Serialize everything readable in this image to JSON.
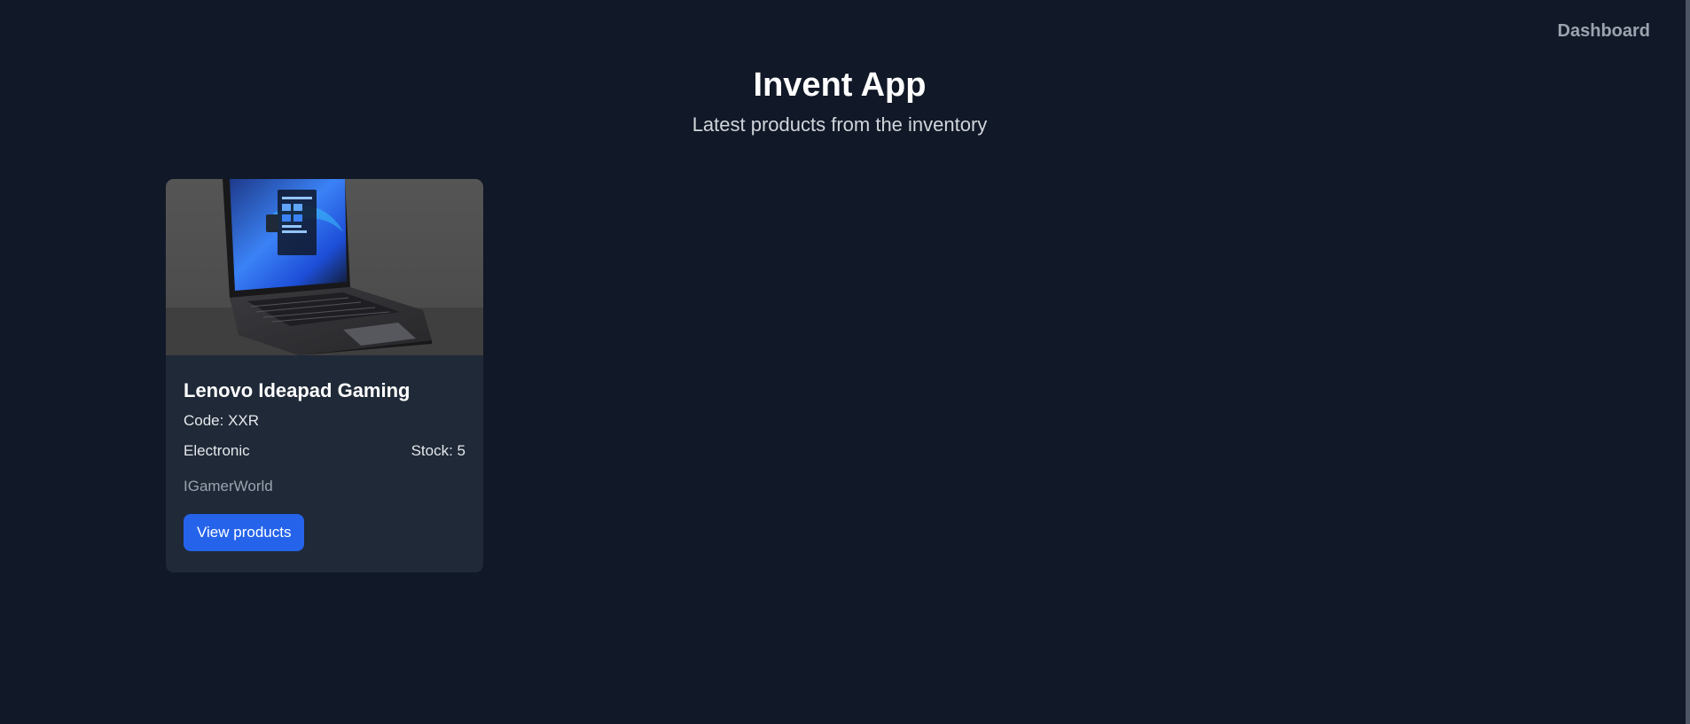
{
  "nav": {
    "dashboard_label": "Dashboard"
  },
  "header": {
    "title": "Invent App",
    "subtitle": "Latest products from the inventory"
  },
  "products": [
    {
      "name": "Lenovo Ideapad Gaming",
      "code": "Code: XXR",
      "category": "Electronic",
      "stock": "Stock: 5",
      "vendor": "IGamerWorld",
      "button_label": "View products",
      "image_icon": "laptop-image"
    }
  ],
  "colors": {
    "background": "#111827",
    "card": "#1f2937",
    "accent": "#2563eb"
  }
}
